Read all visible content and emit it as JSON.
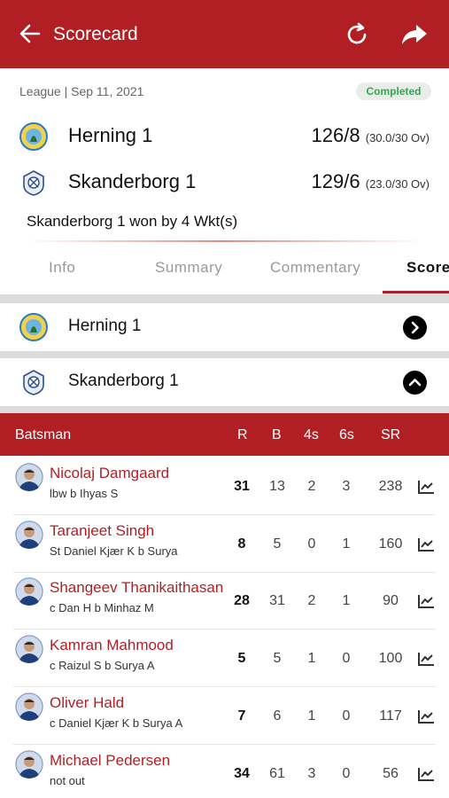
{
  "app": {
    "title": "Scorecard"
  },
  "match": {
    "meta": "League | Sep 11, 2021",
    "status": "Completed",
    "status_color": "#2eaa4e",
    "result": "Skanderborg 1 won by 4 Wkt(s)",
    "teams": [
      {
        "name": "Herning 1",
        "score": "126/8",
        "overs": "(30.0/30 Ov)"
      },
      {
        "name": "Skanderborg 1",
        "score": "129/6",
        "overs": "(23.0/30 Ov)"
      }
    ]
  },
  "tabs": [
    {
      "label": "Info"
    },
    {
      "label": "Summary"
    },
    {
      "label": "Commentary"
    },
    {
      "label": "Score"
    }
  ],
  "innings": [
    {
      "name": "Herning 1",
      "state": "collapsed",
      "icon": "chevron-right-icon"
    },
    {
      "name": "Skanderborg 1",
      "state": "expanded",
      "icon": "chevron-up-icon"
    }
  ],
  "batting": {
    "headers": {
      "batsman": "Batsman",
      "r": "R",
      "b": "B",
      "fours": "4s",
      "sixes": "6s",
      "sr": "SR"
    },
    "rows": [
      {
        "name": "Nicolaj Damgaard",
        "dismissal": "lbw b Ihyas S",
        "r": "31",
        "b": "13",
        "fours": "2",
        "sixes": "3",
        "sr": "238"
      },
      {
        "name": "Taranjeet Singh",
        "dismissal": "St Daniel Kjær K b Surya",
        "r": "8",
        "b": "5",
        "fours": "0",
        "sixes": "1",
        "sr": "160"
      },
      {
        "name": "Shangeev Thanikaithasan",
        "dismissal": "c Dan H b Minhaz M",
        "r": "28",
        "b": "31",
        "fours": "2",
        "sixes": "1",
        "sr": "90"
      },
      {
        "name": "Kamran Mahmood",
        "dismissal": "c Raizul S b Surya A",
        "r": "5",
        "b": "5",
        "fours": "1",
        "sixes": "0",
        "sr": "100"
      },
      {
        "name": "Oliver Hald",
        "dismissal": "c Daniel Kjær K b Surya A",
        "r": "7",
        "b": "6",
        "fours": "1",
        "sixes": "0",
        "sr": "117"
      },
      {
        "name": "Michael Pedersen",
        "dismissal": "not out",
        "r": "34",
        "b": "61",
        "fours": "3",
        "sixes": "0",
        "sr": "56"
      }
    ]
  },
  "colors": {
    "brand": "#b11f24",
    "accent_text": "#b11f24"
  }
}
